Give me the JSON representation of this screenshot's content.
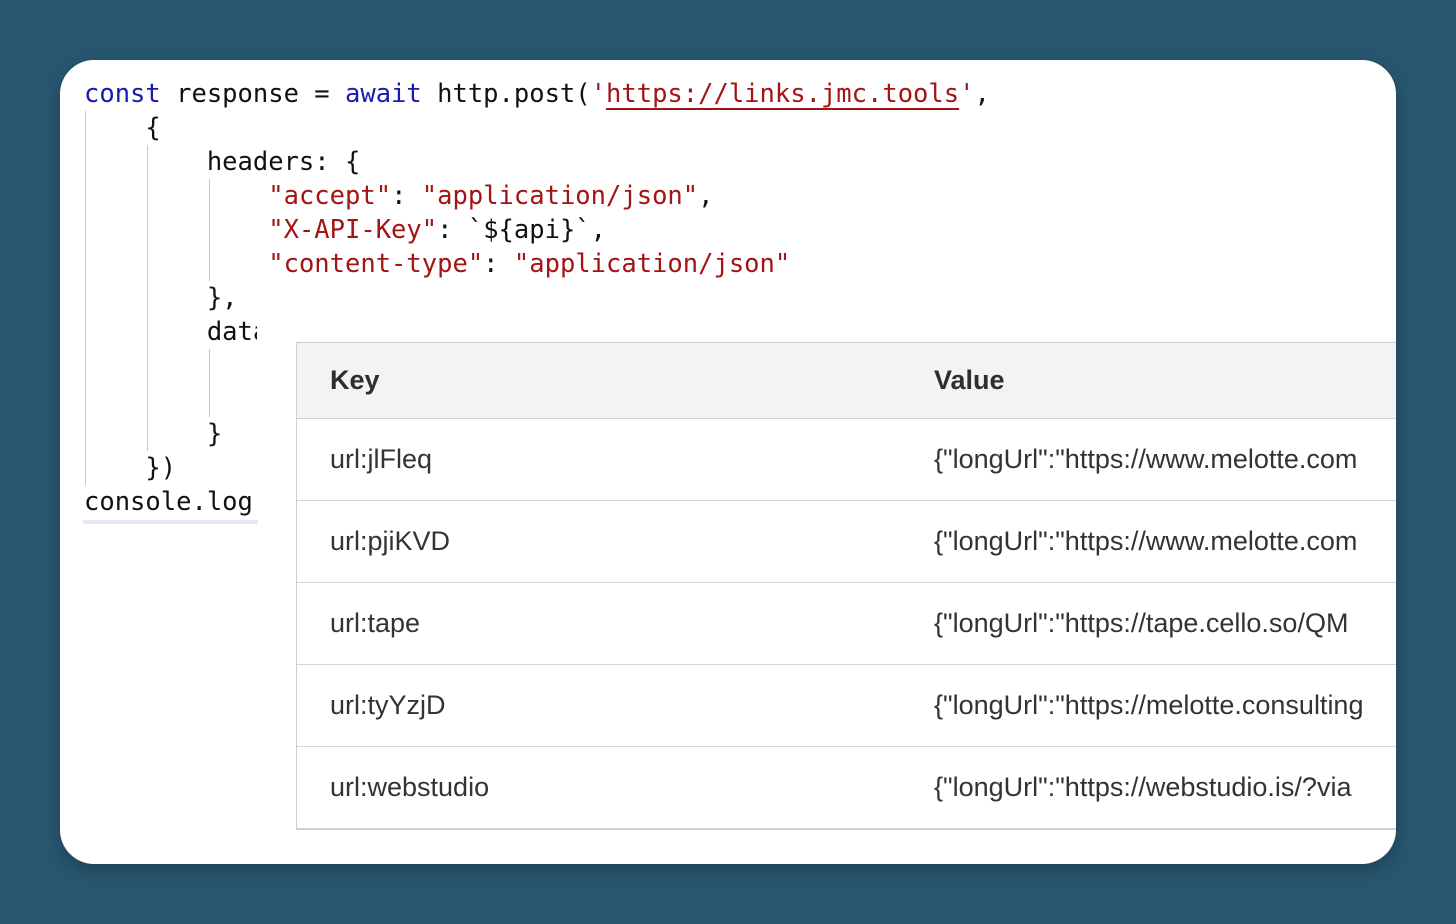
{
  "code": {
    "lines": {
      "l1": {
        "kw1": "const",
        "t1": " response = ",
        "kw2": "await",
        "t2": " http.post(",
        "q1": "'",
        "url": "https://links.jmc.tools",
        "q2": "'",
        "t3": ","
      },
      "l2": "    {",
      "l3": "        headers: {",
      "l4": {
        "indent": "            ",
        "k": "\"accept\"",
        "sep": ": ",
        "v": "\"application/json\"",
        "end": ","
      },
      "l5": {
        "indent": "            ",
        "k": "\"X-API-Key\"",
        "sep": ": ",
        "v": "`${api}`",
        "end": ","
      },
      "l6": {
        "indent": "            ",
        "k": "\"content-type\"",
        "sep": ": ",
        "v": "\"application/json\""
      },
      "l7": "        },",
      "l8": {
        "indent": "        ",
        "partial": "data"
      },
      "l9": "",
      "l10": "",
      "l11": "        }",
      "l12": "    })",
      "l13": "console.log"
    }
  },
  "table": {
    "headers": {
      "key": "Key",
      "value": "Value"
    },
    "rows": [
      {
        "key": "url:jlFleq",
        "value": "{\"longUrl\":\"https://www.melotte.com"
      },
      {
        "key": "url:pjiKVD",
        "value": "{\"longUrl\":\"https://www.melotte.com"
      },
      {
        "key": "url:tape",
        "value": "{\"longUrl\":\"https://tape.cello.so/QM"
      },
      {
        "key": "url:tyYzjD",
        "value": "{\"longUrl\":\"https://melotte.consulting"
      },
      {
        "key": "url:webstudio",
        "value": "{\"longUrl\":\"https://webstudio.is/?via"
      }
    ]
  },
  "colors": {
    "background": "#285770",
    "keyword": "#1a1ab0",
    "string": "#a31515",
    "text": "#111111"
  }
}
